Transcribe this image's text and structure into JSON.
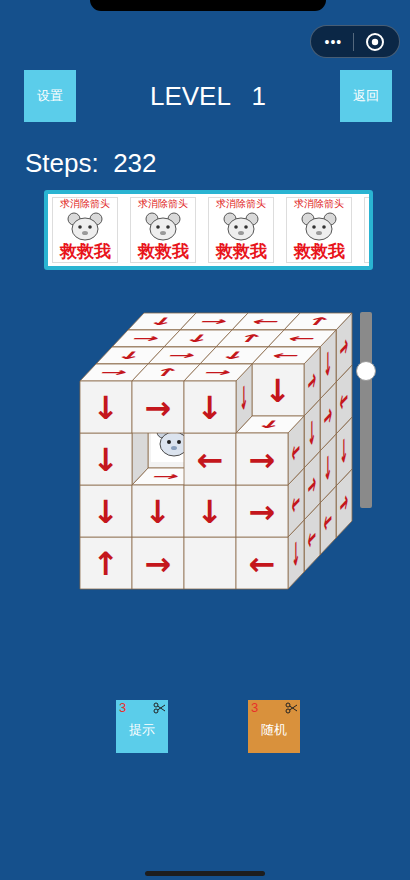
{
  "status_bar": {
    "menu_glyph": "•••"
  },
  "header": {
    "settings": "设置",
    "title": "LEVEL   1",
    "back": "返回"
  },
  "steps": "Steps:  232",
  "banner": {
    "cards": [
      {
        "kind": "full",
        "request": "求消除箭头",
        "plea": "救救我"
      },
      {
        "kind": "full",
        "request": "求消除箭头",
        "plea": "救救我"
      },
      {
        "kind": "full",
        "request": "求消除箭头",
        "plea": "救救我"
      },
      {
        "kind": "full",
        "request": "求消除箭头",
        "plea": "救救我"
      },
      {
        "kind": "cut"
      }
    ]
  },
  "slider": {
    "level": 0.7
  },
  "cube": {
    "blocks": [
      {
        "kind": "arrow",
        "col": 0,
        "row": 0,
        "depth": 0,
        "front": "↓",
        "top": "→"
      },
      {
        "kind": "arrow",
        "col": 1,
        "row": 0,
        "depth": 0,
        "front": "→",
        "top": "↑"
      },
      {
        "kind": "arrow",
        "col": 2,
        "row": 0,
        "depth": 0,
        "front": "↓",
        "top": "→",
        "right": "↓"
      },
      {
        "kind": "arrow",
        "col": 0,
        "row": 1,
        "depth": 0,
        "front": "↓"
      },
      {
        "kind": "arrow",
        "col": 2,
        "row": 1,
        "depth": 0,
        "front": "←"
      },
      {
        "kind": "arrow",
        "col": 3,
        "row": 1,
        "depth": 0,
        "front": "→",
        "top": "↓",
        "right": "←"
      },
      {
        "kind": "arrow",
        "col": 0,
        "row": 2,
        "depth": 0,
        "front": "↓"
      },
      {
        "kind": "arrow",
        "col": 1,
        "row": 2,
        "depth": 0,
        "front": "↓",
        "top": "→"
      },
      {
        "kind": "arrow",
        "col": 2,
        "row": 2,
        "depth": 0,
        "front": "↓"
      },
      {
        "kind": "arrow",
        "col": 3,
        "row": 2,
        "depth": 0,
        "front": "→",
        "right": "←"
      },
      {
        "kind": "arrow",
        "col": 0,
        "row": 3,
        "depth": 0,
        "front": "↑"
      },
      {
        "kind": "arrow",
        "col": 1,
        "row": 3,
        "depth": 0,
        "front": "→"
      },
      {
        "kind": "arrow",
        "col": 2,
        "row": 3,
        "depth": 0
      },
      {
        "kind": "arrow",
        "col": 3,
        "row": 3,
        "depth": 0,
        "front": "←",
        "right": "↓"
      },
      {
        "kind": "arrow",
        "col": 0,
        "row": 0,
        "depth": 1,
        "top": "↓"
      },
      {
        "kind": "arrow",
        "col": 1,
        "row": 0,
        "depth": 1,
        "top": "→"
      },
      {
        "kind": "arrow",
        "col": 2,
        "row": 0,
        "depth": 1,
        "top": "↓"
      },
      {
        "kind": "arrow",
        "col": 3,
        "row": 0,
        "depth": 1,
        "front": "↓",
        "top": "←",
        "right": "→"
      },
      {
        "kind": "captive",
        "col": 1,
        "row": 1,
        "depth": 1
      },
      {
        "kind": "arrow",
        "col": 3,
        "row": 1,
        "depth": 1,
        "right": "↓"
      },
      {
        "kind": "arrow",
        "col": 3,
        "row": 2,
        "depth": 1,
        "right": "→"
      },
      {
        "kind": "arrow",
        "col": 3,
        "row": 3,
        "depth": 1,
        "right": "←"
      },
      {
        "kind": "arrow",
        "col": 0,
        "row": 0,
        "depth": 2,
        "top": "→"
      },
      {
        "kind": "arrow",
        "col": 1,
        "row": 0,
        "depth": 2,
        "top": "↓"
      },
      {
        "kind": "arrow",
        "col": 2,
        "row": 0,
        "depth": 2,
        "top": "↑"
      },
      {
        "kind": "arrow",
        "col": 3,
        "row": 0,
        "depth": 2,
        "top": "←",
        "right": "↓"
      },
      {
        "kind": "arrow",
        "col": 3,
        "row": 1,
        "depth": 2,
        "right": "→"
      },
      {
        "kind": "arrow",
        "col": 3,
        "row": 2,
        "depth": 2,
        "right": "↓"
      },
      {
        "kind": "arrow",
        "col": 3,
        "row": 3,
        "depth": 2,
        "right": "←"
      },
      {
        "kind": "arrow",
        "col": 0,
        "row": 0,
        "depth": 3,
        "top": "↓"
      },
      {
        "kind": "arrow",
        "col": 1,
        "row": 0,
        "depth": 3,
        "top": "→"
      },
      {
        "kind": "arrow",
        "col": 2,
        "row": 0,
        "depth": 3,
        "top": "←"
      },
      {
        "kind": "arrow",
        "col": 3,
        "row": 0,
        "depth": 3,
        "top": "↑",
        "right": "→"
      },
      {
        "kind": "arrow",
        "col": 3,
        "row": 1,
        "depth": 3,
        "right": "←"
      },
      {
        "kind": "arrow",
        "col": 3,
        "row": 2,
        "depth": 3,
        "right": "↓"
      },
      {
        "kind": "arrow",
        "col": 3,
        "row": 3,
        "depth": 3,
        "right": "→"
      }
    ]
  },
  "tools": [
    {
      "label": "提示",
      "count": "3",
      "color": "#5bcdea"
    },
    {
      "label": "随机",
      "count": "3",
      "color": "#d9913c"
    }
  ]
}
